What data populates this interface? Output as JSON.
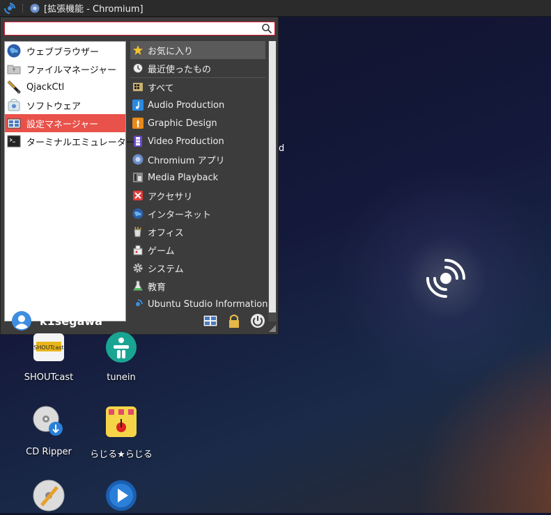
{
  "window": {
    "title": "[拡張機能 - Chromium]"
  },
  "search": {
    "value": "",
    "placeholder": ""
  },
  "favorites": [
    {
      "label": "ウェブブラウザー",
      "icon": "globe-icon"
    },
    {
      "label": "ファイルマネージャー",
      "icon": "folder-icon"
    },
    {
      "label": "QjackCtl",
      "icon": "qjackctl-icon"
    },
    {
      "label": "ソフトウェア",
      "icon": "software-center-icon"
    },
    {
      "label": "設定マネージャー",
      "icon": "settings-manager-icon",
      "active": true
    },
    {
      "label": "ターミナルエミュレーター",
      "icon": "terminal-icon"
    }
  ],
  "categories": [
    {
      "label": "お気に入り",
      "icon": "star-icon"
    },
    {
      "label": "最近使ったもの",
      "icon": "clock-icon"
    },
    {
      "label": "すべて",
      "icon": "all-apps-icon"
    },
    {
      "label": "Audio Production",
      "icon": "music-note-icon"
    },
    {
      "label": "Graphic Design",
      "icon": "brush-icon"
    },
    {
      "label": "Video Production",
      "icon": "film-icon"
    },
    {
      "label": "Chromium アプリ",
      "icon": "chromium-icon"
    },
    {
      "label": "Media Playback",
      "icon": "media-icon"
    },
    {
      "label": "アクセサリ",
      "icon": "accessories-icon"
    },
    {
      "label": "インターネット",
      "icon": "globe-icon"
    },
    {
      "label": "オフィス",
      "icon": "office-icon"
    },
    {
      "label": "ゲーム",
      "icon": "game-icon"
    },
    {
      "label": "システム",
      "icon": "gear-icon"
    },
    {
      "label": "教育",
      "icon": "education-icon"
    },
    {
      "label": "Ubuntu Studio Information",
      "icon": "info-icon"
    }
  ],
  "user": {
    "name": "k1segawa"
  },
  "desktop": {
    "partial_text": "d",
    "icons": [
      {
        "label": "SHOUTcast",
        "icon": "shoutcast-icon"
      },
      {
        "label": "tunein",
        "icon": "tunein-icon"
      },
      {
        "label": "CD Ripper",
        "icon": "cd-ripper-icon"
      },
      {
        "label": "らじる★らじる",
        "icon": "radiru-icon"
      },
      {
        "label": "",
        "icon": "cd-burner-icon"
      },
      {
        "label": "",
        "icon": "media-player-icon"
      }
    ]
  },
  "colors": {
    "accent": "#e8524a",
    "panel": "#3c3c3c",
    "user_blue": "#3d8ee0"
  }
}
